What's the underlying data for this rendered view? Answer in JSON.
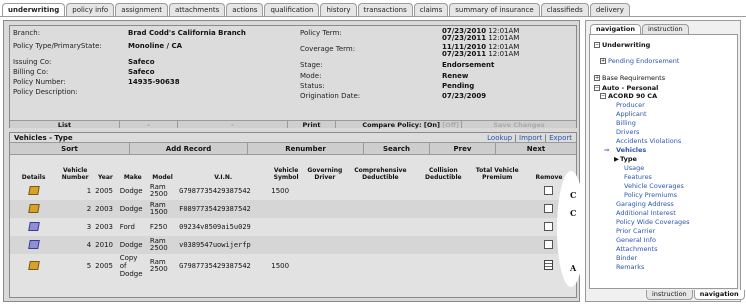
{
  "top_tabs": [
    "underwriting",
    "policy info",
    "assignment",
    "attachments",
    "actions",
    "qualification",
    "history",
    "transactions",
    "claims",
    "summary of insurance",
    "classifieds",
    "delivery"
  ],
  "policy": {
    "branch_label": "Branch:",
    "branch": "Brad Codd's California Branch",
    "policy_type_label": "Policy Type/PrimaryState:",
    "policy_type": "Monoline / CA",
    "issuing_label": "Issuing Co:",
    "issuing": "Safeco",
    "billing_label": "Billing Co:",
    "billing": "Safeco",
    "policy_number_label": "Policy Number:",
    "policy_number": "14935-90638",
    "policy_desc_label": "Policy Description:",
    "policy_term_label": "Policy Term:",
    "policy_term_1": "07/23/2010",
    "policy_term_1_time": "12:01AM",
    "policy_term_2": "07/23/2011",
    "policy_term_2_time": "12:01AM",
    "coverage_term_label": "Coverage Term:",
    "coverage_term_1": "11/11/2010",
    "coverage_term_1_time": "12:01AM",
    "coverage_term_2": "07/23/2011",
    "coverage_term_2_time": "12:01AM",
    "stage_label": "Stage:",
    "stage": "Endorsement",
    "mode_label": "Mode:",
    "mode": "Renew",
    "status_label": "Status:",
    "status": "Pending",
    "origination_label": "Origination Date:",
    "origination": "07/23/2009",
    "bar": {
      "list": "List",
      "dash1": "-",
      "dash2": "-",
      "print": "Print",
      "compare": "Compare Policy: [On]",
      "off": "[Off]",
      "save": "Save Changes"
    }
  },
  "vehicles": {
    "title": "Vehicles - Type",
    "links": {
      "lookup": "Lookup",
      "sep1": " | ",
      "import": "Import",
      "sep2": " | ",
      "export": "Export"
    },
    "actions": [
      "Sort",
      "Add Record",
      "Renumber",
      "Search",
      "Prev",
      "Next"
    ],
    "columns": [
      "Details",
      "Vehicle Number",
      "Year",
      "Make",
      "Model",
      "V.I.N.",
      "Vehicle Symbol",
      "Governing Driver",
      "Comprehensive Deductible",
      "Collision Deductible",
      "Total Vehicle Premium",
      "Remove"
    ],
    "rows": [
      {
        "num": "1",
        "year": "2005",
        "make": "Dodge",
        "model": "Ram 2500",
        "vin": "G7987735429387542",
        "symbol": "1500",
        "mark": "C"
      },
      {
        "num": "2",
        "year": "2003",
        "make": "Dodge",
        "model": "Ram 1500",
        "vin": "F0897735429387542",
        "symbol": "",
        "mark": "C"
      },
      {
        "num": "3",
        "year": "2003",
        "make": "Ford",
        "model": "F250",
        "vin": "09234v8509ai5u029",
        "symbol": "",
        "mark": ""
      },
      {
        "num": "4",
        "year": "2010",
        "make": "Dodge",
        "model": "Ram 2500",
        "vin": "v0389547uowijerfp",
        "symbol": "",
        "mark": ""
      },
      {
        "num": "5",
        "year": "2005",
        "make": "Copy of Dodge",
        "model": "Ram 2500",
        "vin": "G7987735429387542",
        "symbol": "1500",
        "mark": "A"
      }
    ]
  },
  "nav": {
    "tabs": [
      "navigation",
      "instruction"
    ],
    "bottom_tabs": [
      "instruction",
      "navigation"
    ],
    "items": [
      {
        "label": "Underwriting",
        "box": "−",
        "cls": "b"
      },
      {
        "label": "Pending Endorsement",
        "box": "+",
        "cls": "link"
      },
      {
        "label": "Base Requirements",
        "box": "+",
        "cls": ""
      },
      {
        "label": "Auto - Personal",
        "box": "−",
        "cls": "b"
      },
      {
        "label": "ACORD 90 CA",
        "box": "−",
        "cls": "b"
      },
      {
        "label": "Producer",
        "cls": "link"
      },
      {
        "label": "Applicant",
        "cls": "link"
      },
      {
        "label": "Billing",
        "cls": "link"
      },
      {
        "label": "Drivers",
        "cls": "link"
      },
      {
        "label": "Accidents Violations",
        "cls": "link"
      },
      {
        "label": "Vehicles",
        "cls": "link b"
      },
      {
        "label": "Type",
        "cls": "b"
      },
      {
        "label": "Usage",
        "cls": "link"
      },
      {
        "label": "Features",
        "cls": "link"
      },
      {
        "label": "Vehicle Coverages",
        "cls": "link"
      },
      {
        "label": "Policy Premiums",
        "cls": "link"
      },
      {
        "label": "Garaging Address",
        "cls": "link"
      },
      {
        "label": "Additional Interest",
        "cls": "link"
      },
      {
        "label": "Policy Wide Coverages",
        "cls": "link"
      },
      {
        "label": "Prior Carrier",
        "cls": "link"
      },
      {
        "label": "General Info",
        "cls": "link"
      },
      {
        "label": "Attachments",
        "cls": "link"
      },
      {
        "label": "Binder",
        "cls": "link"
      },
      {
        "label": "Remarks",
        "cls": "link"
      }
    ]
  }
}
